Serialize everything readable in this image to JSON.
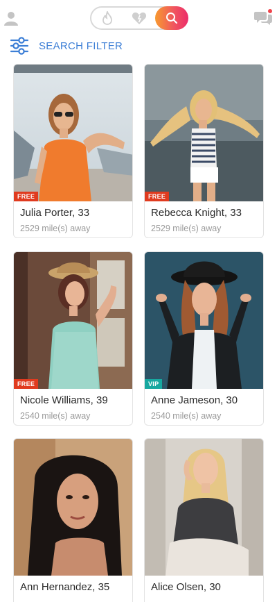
{
  "header": {
    "segments": [
      {
        "name": "hot",
        "icon": "flame-icon",
        "active": false
      },
      {
        "name": "likes",
        "icon": "heart-icon",
        "active": false
      },
      {
        "name": "search",
        "icon": "search-icon",
        "active": true
      }
    ],
    "accent_gradient": [
      "#f79a2f",
      "#f0575e",
      "#ec2c6a"
    ]
  },
  "filter": {
    "label": "SEARCH FILTER",
    "color": "#3d7fd6"
  },
  "profiles": [
    {
      "name": "Julia Porter, 33",
      "distance": "2529 mile(s) away",
      "badge": "FREE"
    },
    {
      "name": "Rebecca Knight, 33",
      "distance": "2529 mile(s) away",
      "badge": "FREE"
    },
    {
      "name": "Nicole Williams, 39",
      "distance": "2540 mile(s) away",
      "badge": "FREE"
    },
    {
      "name": "Anne Jameson, 30",
      "distance": "2540 mile(s) away",
      "badge": "VIP"
    },
    {
      "name": "Ann Hernandez, 35",
      "distance": "",
      "badge": ""
    },
    {
      "name": "Alice Olsen, 30",
      "distance": "",
      "badge": ""
    }
  ],
  "badge_colors": {
    "FREE": "#e03b1f",
    "VIP": "#17a8a0"
  }
}
